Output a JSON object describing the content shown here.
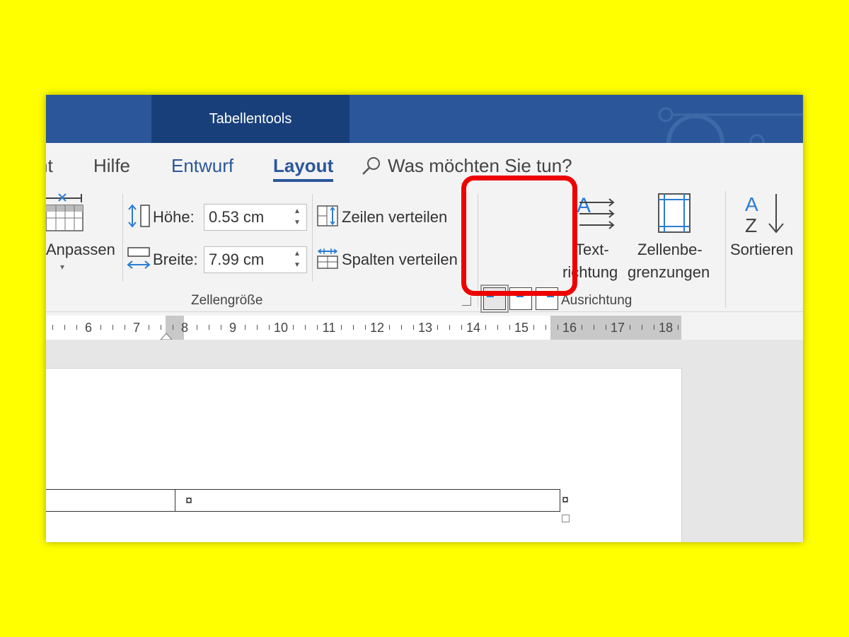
{
  "titlebar": {
    "context_tab": "Tabellentools"
  },
  "tabs": [
    {
      "label": "nt"
    },
    {
      "label": "Hilfe"
    },
    {
      "label": "Entwurf"
    },
    {
      "label": "Layout"
    }
  ],
  "tell_me": {
    "label": "Was möchten Sie tun?"
  },
  "ribbon": {
    "anpassen_label": "Anpassen",
    "zellengroesse": {
      "hoehe_label": "Höhe:",
      "hoehe_value": "0.53 cm",
      "breite_label": "Breite:",
      "breite_value": "7.99 cm",
      "zeilen_label": "Zeilen verteilen",
      "spalten_label": "Spalten verteilen",
      "group_label": "Zellengröße"
    },
    "ausrichtung": {
      "textrichtung_line1": "Text-",
      "textrichtung_line2": "richtung",
      "zellenbegrenzungen_line1": "Zellenbe-",
      "zellenbegrenzungen_line2": "grenzungen",
      "group_label": "Ausrichtung"
    },
    "sortieren_label": "Sortieren",
    "sort_letters": {
      "a": "A",
      "z": "Z"
    }
  },
  "ruler": {
    "numbers": [
      "6",
      "7",
      "8",
      "9",
      "10",
      "11",
      "12",
      "13",
      "14",
      "15",
      "16",
      "17",
      "18"
    ]
  },
  "document": {
    "cell_mark": "¤",
    "row_mark": "¤"
  },
  "colors": {
    "ribbon_blue": "#2b579a",
    "context_tab": "#183f7a",
    "highlight": "#ee0000",
    "icon_blue": "#2b7cd3"
  }
}
